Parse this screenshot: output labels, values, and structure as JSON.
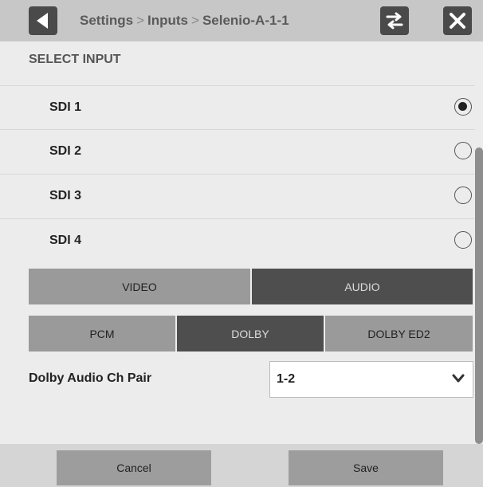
{
  "header": {
    "breadcrumb": [
      "Settings",
      "Inputs",
      "Selenio-A-1-1"
    ],
    "separator": ">",
    "icons": [
      "back-icon",
      "swap-icon",
      "close-icon"
    ]
  },
  "select_input": {
    "title": "SELECT INPUT",
    "inputs": [
      {
        "label": "SDI 1",
        "selected": true
      },
      {
        "label": "SDI 2",
        "selected": false
      },
      {
        "label": "SDI 3",
        "selected": false
      },
      {
        "label": "SDI 4",
        "selected": false
      }
    ]
  },
  "mode_tabs": {
    "items": [
      "VIDEO",
      "AUDIO"
    ],
    "active": "AUDIO"
  },
  "audio_tabs": {
    "items": [
      "PCM",
      "DOLBY",
      "DOLBY ED2"
    ],
    "active": "DOLBY"
  },
  "dolby_pair": {
    "label": "Dolby Audio Ch Pair",
    "value": "1-2"
  },
  "footer": {
    "cancel_label": "Cancel",
    "save_label": "Save"
  },
  "colors": {
    "header_bg": "#c7c7c7",
    "panel_bg": "#ececec",
    "tab_active": "#4e4e4e",
    "tab_inactive": "#9a9a9a",
    "button_bg": "#9d9d9d"
  }
}
